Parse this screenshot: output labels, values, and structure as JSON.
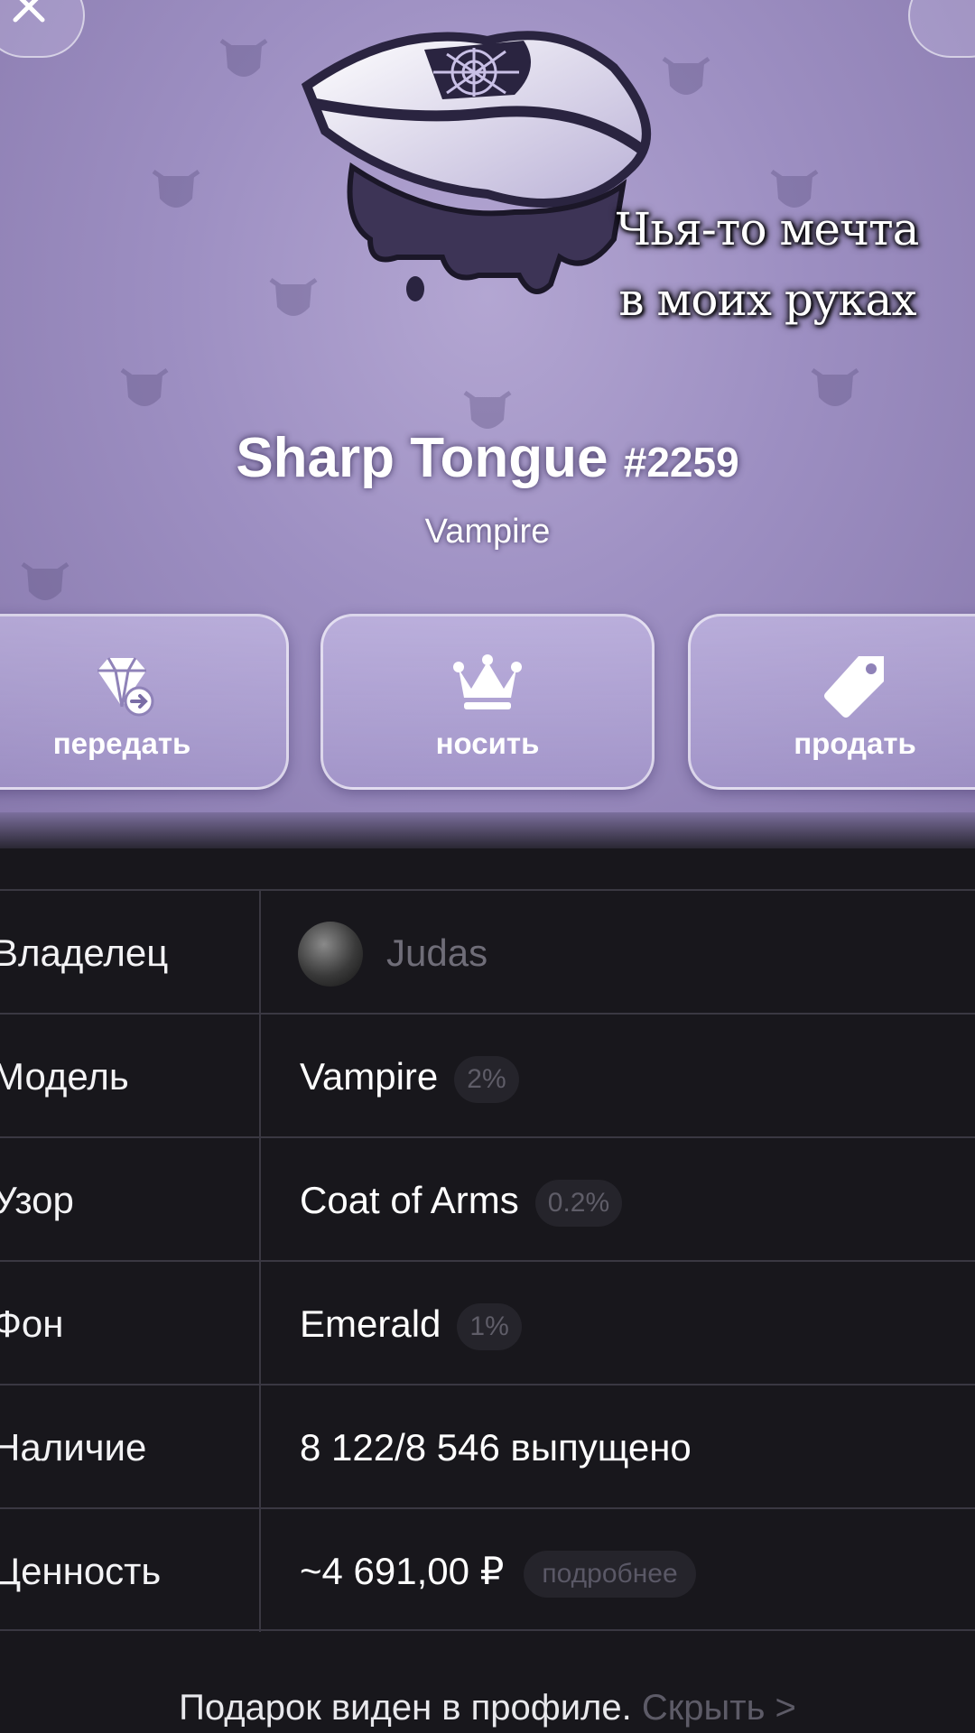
{
  "header": {
    "caption_line1": "Чья-то мечта",
    "caption_line2": "в моих руках",
    "title": "Sharp Tongue",
    "number": "#2259",
    "subtitle": "Vampire"
  },
  "actions": [
    {
      "label": "передать",
      "icon": "gem-transfer-icon"
    },
    {
      "label": "носить",
      "icon": "crown-icon"
    },
    {
      "label": "продать",
      "icon": "price-tag-icon"
    }
  ],
  "details": {
    "owner": {
      "key": "Владелец",
      "value": "Judas"
    },
    "model": {
      "key": "Модель",
      "value": "Vampire",
      "percent": "2%"
    },
    "pattern": {
      "key": "Узор",
      "value": "Coat of Arms",
      "percent": "0.2%"
    },
    "background": {
      "key": "Фон",
      "value": "Emerald",
      "percent": "1%"
    },
    "availability": {
      "key": "Наличие",
      "value": "8 122/8 546 выпущено"
    },
    "worth": {
      "key": "Ценность",
      "value": "~4 691,00 ₽",
      "link": "подробнее"
    }
  },
  "footer": {
    "text": "Подарок виден в профиле.",
    "link": "Скрыть >"
  },
  "colors": {
    "hero_bg": "#9d8fc2",
    "panel_bg": "#18171c",
    "divider": "#3a3842"
  }
}
